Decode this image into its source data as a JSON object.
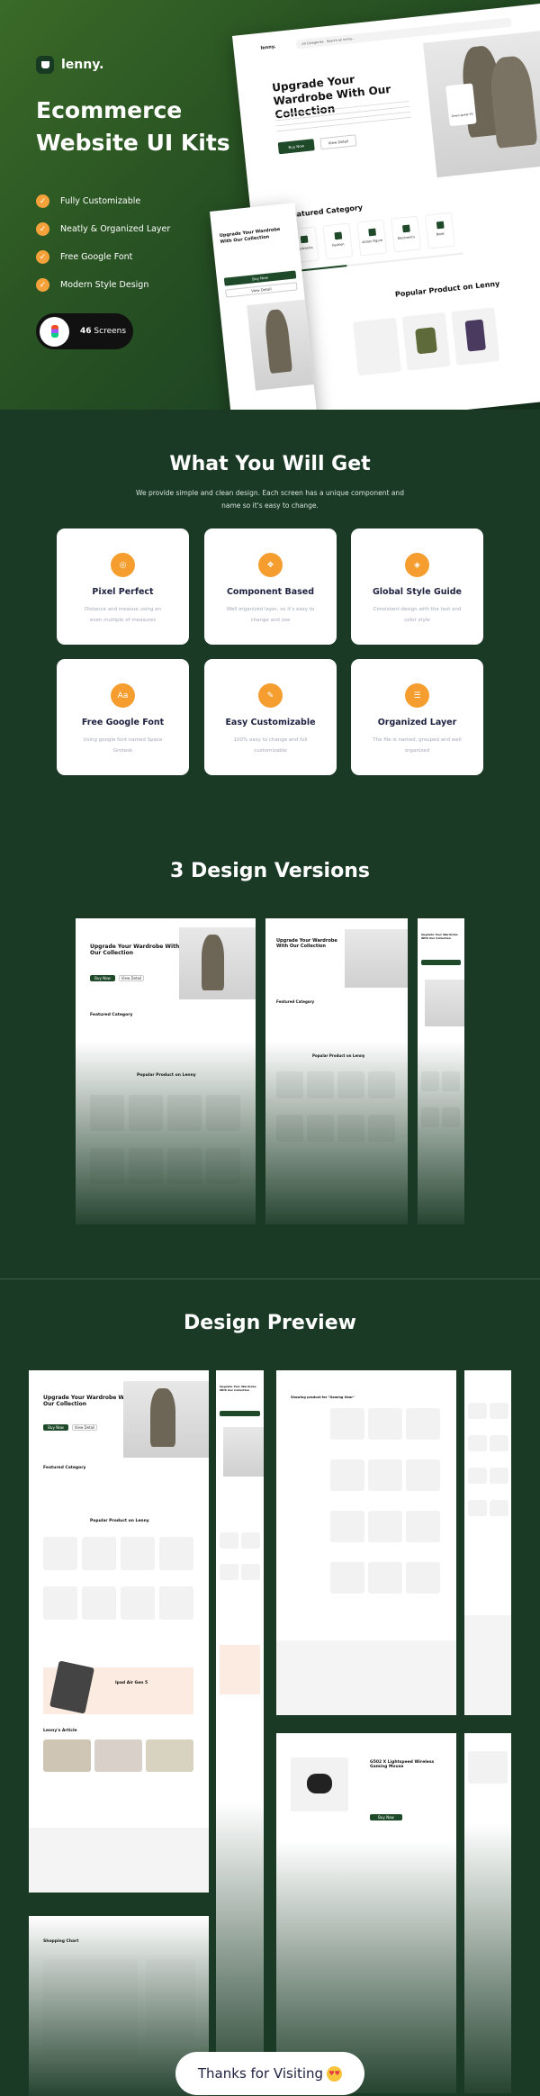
{
  "brand": {
    "name": "lenny."
  },
  "hero": {
    "title": "Ecommerce Website UI Kits",
    "features": [
      "Fully Customizable",
      "Neatly & Organized Layer",
      "Free Google Font",
      "Modern Style Design"
    ],
    "badge": {
      "count": "46",
      "label": "Screens"
    }
  },
  "mockup": {
    "logo": "lenny.",
    "category_select": "All Categories",
    "search_placeholder": "Search on lenny...",
    "headline": "Upgrade Your Wardrobe With Our Collection",
    "buy_now": "Buy Now",
    "view_detail": "View Detail",
    "product_card": "Green Jacket V2",
    "featured_category": "Featured Category",
    "categories": [
      "Electronics",
      "Fashion",
      "Action Figure",
      "Electronics",
      "Book",
      "Gaming"
    ],
    "popular": "Popular Product on Lenny",
    "ipad": "Ipad Air Gen 5",
    "articles": "Lenny's Article",
    "cart": "Shopping Chart",
    "product_detail": "G502 X Lightspeed Wireless Gaming Mouse",
    "search_result": "Showing product for \"Gaming Gear\""
  },
  "what_you_get": {
    "title": "What You Will Get",
    "subtitle": "We provide simple and clean design. Each screen has a unique component and name so it's easy to change.",
    "cards": [
      {
        "title": "Pixel Perfect",
        "desc": "Distance and measue using an even multiple of measures",
        "icon": "target-icon"
      },
      {
        "title": "Component Based",
        "desc": "Well organized layer, so it's easy to change and use",
        "icon": "component-icon"
      },
      {
        "title": "Global Style Guide",
        "desc": "Consistent design with the text and color style",
        "icon": "style-icon"
      },
      {
        "title": "Free Google Font",
        "desc": "Using google font named Space Grotesk",
        "icon": "font-icon"
      },
      {
        "title": "Easy Customizable",
        "desc": "100% easy to change and full customizable",
        "icon": "customize-icon"
      },
      {
        "title": "Organized Layer",
        "desc": "The file is named, grouped and well organized",
        "icon": "layers-icon"
      }
    ]
  },
  "versions": {
    "title": "3 Design Versions"
  },
  "preview": {
    "title": "Design Preview"
  },
  "footer": {
    "thanks": "Thanks for Visiting"
  },
  "colors": {
    "brand_green": "#1f4a2a",
    "accent_orange": "#f59e2f",
    "background": "#1a3a25"
  }
}
